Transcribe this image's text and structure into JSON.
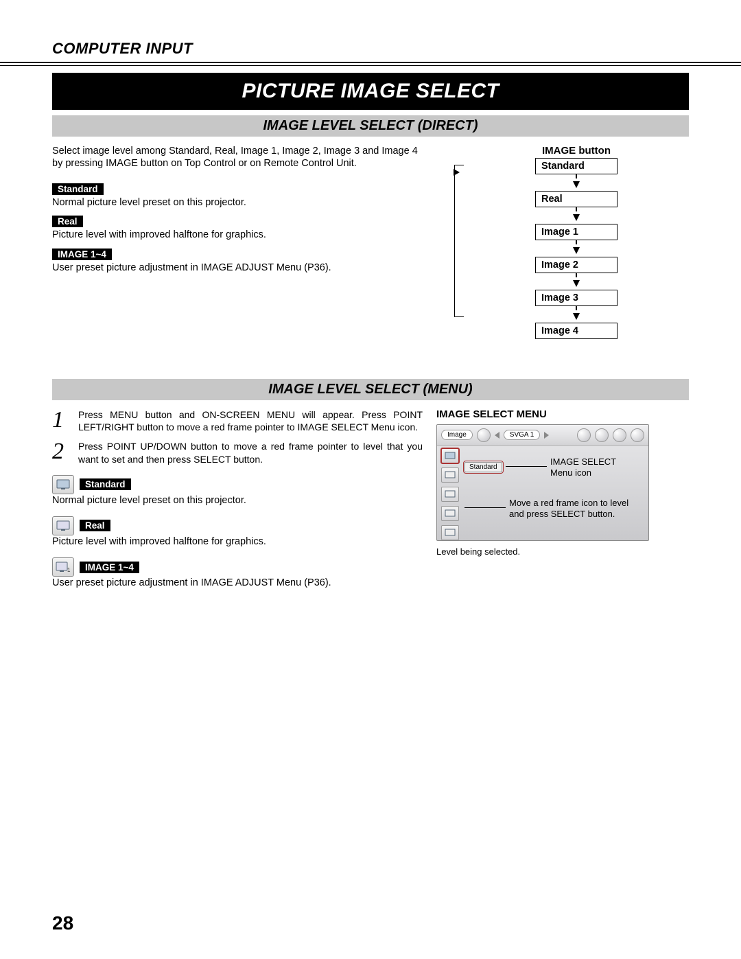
{
  "chapter": "COMPUTER INPUT",
  "title_bar": "PICTURE IMAGE SELECT",
  "section_direct": {
    "heading": "IMAGE LEVEL SELECT (DIRECT)",
    "intro": "Select image level among Standard, Real, Image 1, Image 2, Image 3 and Image 4 by pressing IMAGE button on Top Control or on Remote Control Unit.",
    "items": [
      {
        "tag": "Standard",
        "desc": "Normal picture level preset on this projector."
      },
      {
        "tag": "Real",
        "desc": "Picture level with improved halftone for graphics."
      },
      {
        "tag": "IMAGE 1~4",
        "desc": "User preset picture adjustment in IMAGE ADJUST Menu (P36)."
      }
    ],
    "diagram_title": "IMAGE button",
    "diagram_levels": [
      "Standard",
      "Real",
      "Image 1",
      "Image 2",
      "Image 3",
      "Image 4"
    ]
  },
  "section_menu": {
    "heading": "IMAGE LEVEL SELECT (MENU)",
    "steps": [
      "Press MENU button and ON-SCREEN MENU will appear.  Press POINT LEFT/RIGHT button to move a red frame pointer to IMAGE SELECT Menu icon.",
      "Press POINT UP/DOWN button to move a red frame pointer to level that you want to set and then press SELECT button."
    ],
    "items": [
      {
        "tag": "Standard",
        "desc": "Normal picture level preset on this projector."
      },
      {
        "tag": "Real",
        "desc": "Picture level with improved halftone for graphics."
      },
      {
        "tag": "IMAGE 1~4",
        "desc": "User preset picture adjustment in IMAGE ADJUST Menu (P36)."
      }
    ],
    "osd_title": "IMAGE SELECT MENU",
    "osd_tab_label": "Image",
    "osd_mode_label": "SVGA 1",
    "osd_selected_label": "Standard",
    "callout_icon": "IMAGE SELECT Menu icon",
    "callout_move": "Move a red frame icon to level and press SELECT button.",
    "caption": "Level being selected."
  },
  "page_number": "28"
}
